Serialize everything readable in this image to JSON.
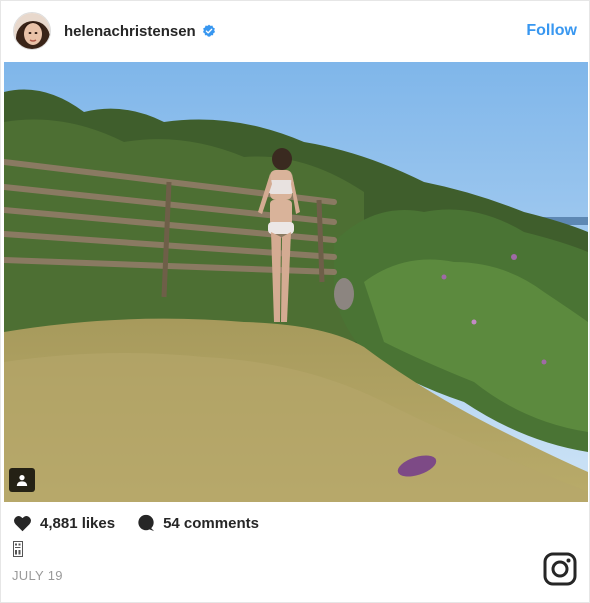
{
  "post": {
    "username": "helenachristensen",
    "follow_label": "Follow",
    "likes_text": "4,881 likes",
    "comments_text": "54 comments",
    "date_text": "JULY 19"
  },
  "icons": {
    "verified": "verified-badge-icon",
    "like": "heart-icon",
    "comment": "comment-bubble-icon",
    "tag": "user-tag-icon",
    "alt_text": "alt-text-icon",
    "logo": "instagram-icon"
  },
  "colors": {
    "accent": "#3897f0",
    "text": "#262626",
    "muted": "#999999"
  }
}
